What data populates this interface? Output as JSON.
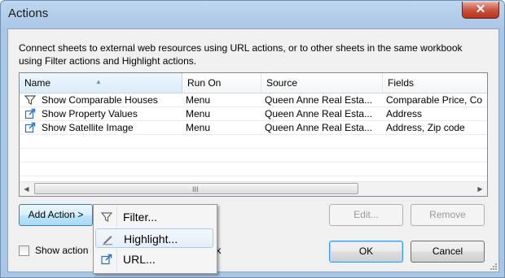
{
  "window": {
    "title": "Actions",
    "close_glyph": "✕"
  },
  "description": "Connect sheets to external web resources using URL actions, or to other sheets in the same workbook using Filter actions and Highlight actions.",
  "table": {
    "columns": [
      "Name",
      "Run On",
      "Source",
      "Fields"
    ],
    "rows": [
      {
        "icon": "filter-icon",
        "name": "Show Comparable Houses",
        "run_on": "Menu",
        "source": "Queen Anne Real Esta...",
        "fields": "Comparable Price, Co"
      },
      {
        "icon": "url-link-icon",
        "name": "Show Property Values",
        "run_on": "Menu",
        "source": "Queen Anne Real Esta...",
        "fields": "Address"
      },
      {
        "icon": "url-link-icon",
        "name": "Show Satellite Image",
        "run_on": "Menu",
        "source": "Queen Anne Real Esta...",
        "fields": "Address, Zip code"
      }
    ],
    "scroll_grip": "III"
  },
  "buttons": {
    "add_action": "Add Action >",
    "edit": "Edit...",
    "remove": "Remove",
    "ok": "OK",
    "cancel": "Cancel"
  },
  "checkbox": {
    "label_visible_left": "Show action",
    "label_visible_right": "kbook",
    "checked": false
  },
  "menu": {
    "items": [
      {
        "label": "Filter...",
        "icon": "filter-icon"
      },
      {
        "label": "Highlight...",
        "icon": "highlight-pen-icon",
        "hovered": true
      },
      {
        "label": "URL...",
        "icon": "url-link-icon"
      }
    ]
  },
  "colors": {
    "accent": "#3399ff",
    "titlebar": "#bfd6ee",
    "close": "#c9503c",
    "icon_blue": "#2f6fbf"
  }
}
